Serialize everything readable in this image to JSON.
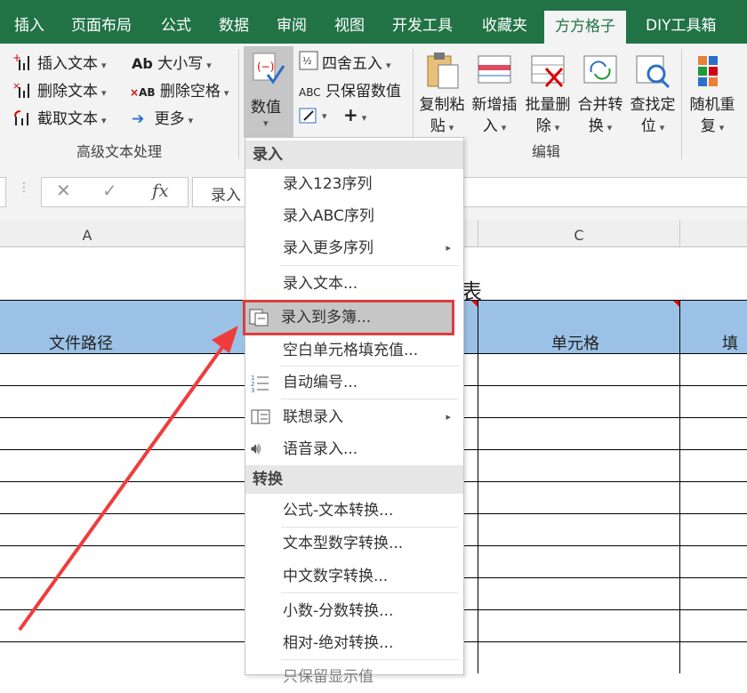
{
  "tabs": [
    "插入",
    "页面布局",
    "公式",
    "数据",
    "审阅",
    "视图",
    "开发工具",
    "收藏夹",
    "方方格子",
    "DIY工具箱"
  ],
  "active_tab": "方方格子",
  "ribbon": {
    "text_group": {
      "insert_text": "插入文本",
      "delete_text": "删除文本",
      "extract_text": "截取文本",
      "case": "大小写",
      "remove_spaces": "删除空格",
      "more": "更多",
      "label": "高级文本处理"
    },
    "value_button": "数值",
    "round": "四舍五入",
    "keep_values": "只保留数值",
    "edit_group": {
      "copy_paste": [
        "复制粘",
        "贴"
      ],
      "insert_new": [
        "新增插",
        "入"
      ],
      "batch_delete": [
        "批量删",
        "除"
      ],
      "merge_convert": [
        "合并转",
        "换"
      ],
      "find_locate": [
        "查找定",
        "位"
      ],
      "random_repeat": [
        "随机重",
        "复"
      ],
      "label": "编辑"
    }
  },
  "formula_bar": {
    "cell_content": "录入"
  },
  "columns": [
    "A",
    "C"
  ],
  "sheet": {
    "title_partial": "表",
    "headers": [
      "文件路径",
      "单元格",
      "填"
    ]
  },
  "menu": {
    "section_input": "录入",
    "items_input": [
      "录入123序列",
      "录入ABC序列",
      "录入更多序列",
      "录入文本...",
      "录入到多簿...",
      "空白单元格填充值...",
      "自动编号...",
      "联想录入",
      "语音录入..."
    ],
    "section_convert": "转换",
    "items_convert": [
      "公式-文本转换...",
      "文本型数字转换...",
      "中文数字转换...",
      "小数-分数转换...",
      "相对-绝对转换...",
      "只保留显示值"
    ]
  },
  "colors": {
    "tab_bar": "#217346",
    "header_fill": "#9bc2e6",
    "highlight_border": "#e03c3c",
    "arrow": "#f03c3c"
  }
}
